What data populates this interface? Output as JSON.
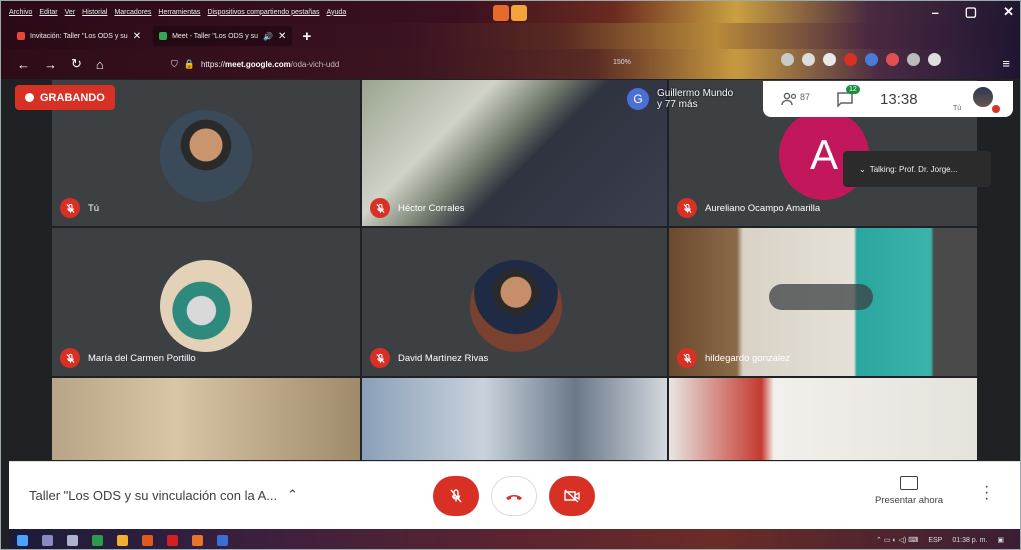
{
  "browser": {
    "menu": [
      "Archivo",
      "Editar",
      "Ver",
      "Historial",
      "Marcadores",
      "Herramientas",
      "Dispositivos compartiendo pestañas",
      "Ayuda"
    ],
    "tabs": [
      {
        "label": "Invitación: Taller \"Los ODS y su",
        "close": "✕",
        "favicon_color": "#e8453c"
      },
      {
        "label": "Meet - Taller \"Los ODS y su",
        "close": "✕",
        "favicon_color": "#34a853"
      }
    ],
    "new_tab": "+",
    "url": {
      "host": "meet.google.com",
      "path": "/oda-vich-udd",
      "scheme": "https://"
    },
    "zoom": "150%",
    "window_controls": [
      "–",
      "▢",
      "✕"
    ]
  },
  "meet": {
    "recording_label": "GRABANDO",
    "overflow": {
      "initial": "G",
      "text_line1": "Guillermo Mundo",
      "text_line2": "y 77 más"
    },
    "people_count": "87",
    "chat_count": "12",
    "time": "13:38",
    "self_label": "Tú",
    "talking": "Talking: Prof. Dr. Jorge...",
    "participants": [
      {
        "name": "Tú"
      },
      {
        "name": "Héctor Corrales"
      },
      {
        "name": "Aureliano Ocampo Amarilla",
        "initial": "A"
      },
      {
        "name": "María del Carmen Portillo"
      },
      {
        "name": "David Martínez Rivas"
      },
      {
        "name": "hildegardo gonzalez"
      }
    ],
    "meeting_title": "Taller \"Los ODS y su vinculación con la A...",
    "present_label": "Presentar ahora"
  },
  "taskbar": {
    "lang": "ESP",
    "time": "01:38 p. m."
  }
}
